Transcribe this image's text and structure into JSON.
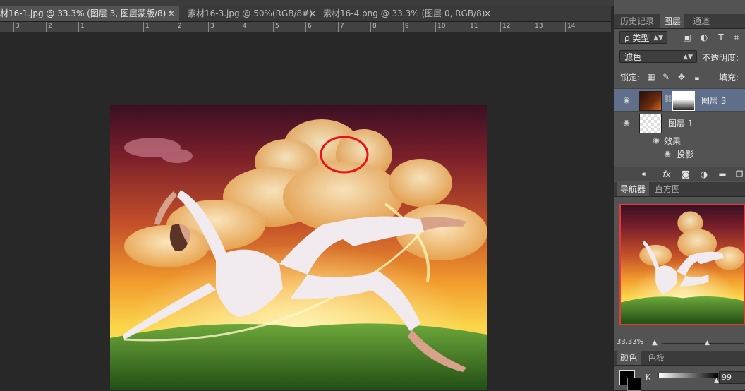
{
  "document_tabs": [
    {
      "label": "材16-1.jpg @ 33.3% (图层 3, 图层蒙版/8) *",
      "active": true
    },
    {
      "label": "素材16-3.jpg @ 50%(RGB/8#)",
      "active": false
    },
    {
      "label": "素材16-4.png @ 33.3% (图层 0, RGB/8)",
      "active": false
    }
  ],
  "tab_close_glyph": "×",
  "ruler_ticks": [
    "3",
    "2",
    "1",
    "1",
    "2",
    "3",
    "4",
    "5",
    "6",
    "7",
    "8",
    "9",
    "10",
    "11",
    "12",
    "13",
    "14"
  ],
  "panel": {
    "tabs": [
      "历史记录",
      "图层",
      "通道"
    ],
    "active_tab": "图层",
    "filter_label": "ρ 类型",
    "blend_mode": "滤色",
    "opacity_label": "不透明度:",
    "lock_label": "锁定:",
    "fill_label": "填充:",
    "layers": [
      {
        "name": "图层 3",
        "selected": true
      },
      {
        "name": "图层 1",
        "selected": false
      }
    ],
    "effects_label": "效果",
    "drop_shadow_label": "投影",
    "footer_icons": [
      "link-icon",
      "fx-icon",
      "mask-icon",
      "adjustment-icon",
      "folder-icon",
      "new-layer-icon"
    ],
    "fx_label": "fx"
  },
  "navigator": {
    "tabs": [
      "导航器",
      "直方图"
    ],
    "zoom": "33.33%"
  },
  "color_panel": {
    "tabs": [
      "颜色",
      "色板"
    ],
    "channel_label": "K",
    "value": "99",
    "k_fraction": 0.99
  },
  "colors": {
    "selection_ring": "#e8121b",
    "navigator_border": "#e03a3a",
    "selected_layer": "#5f6f89"
  }
}
